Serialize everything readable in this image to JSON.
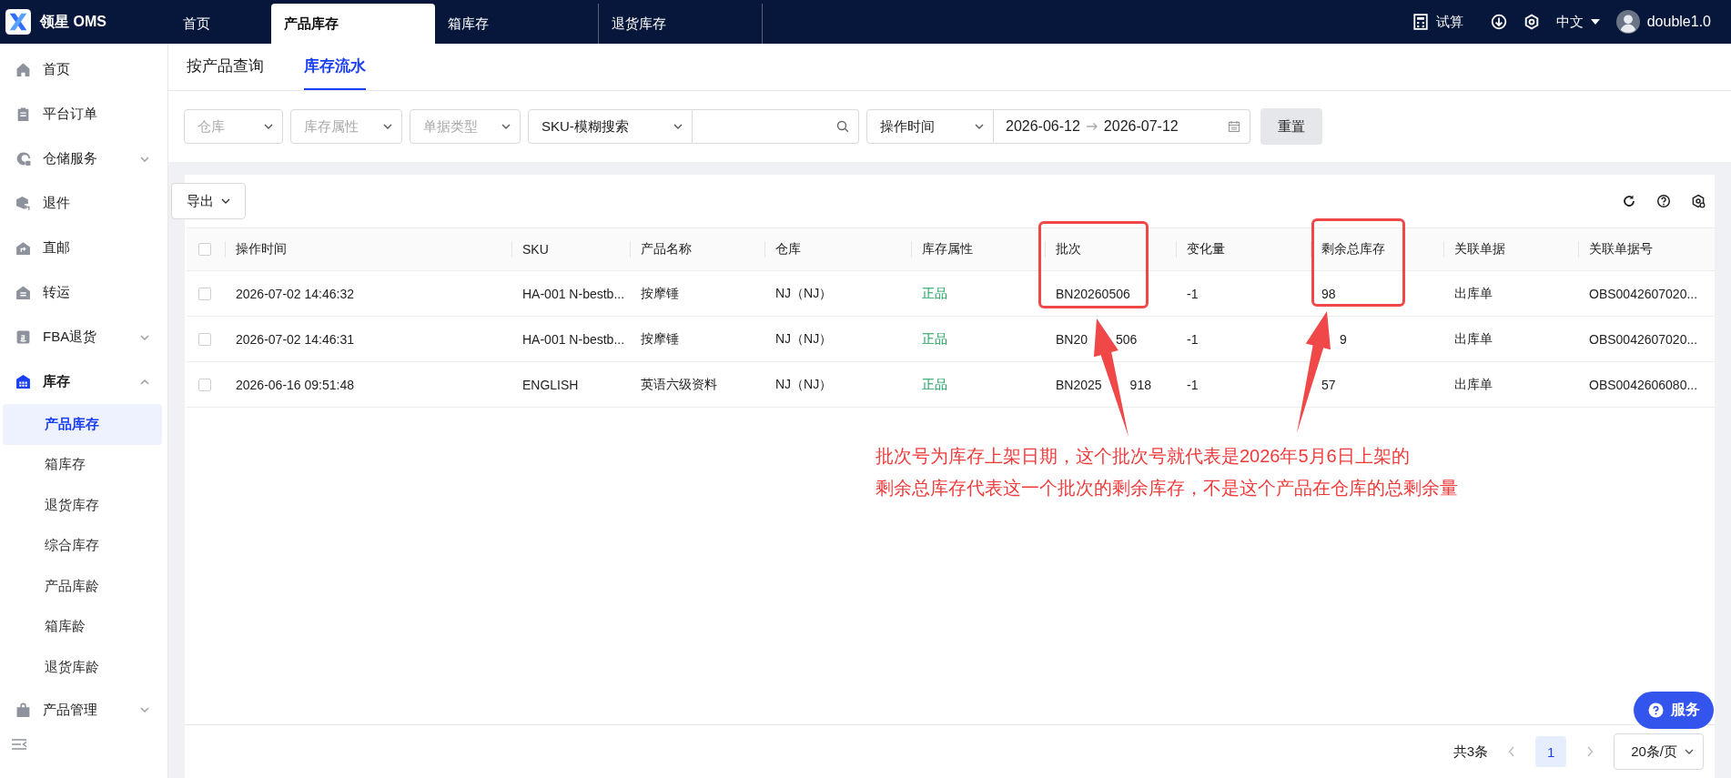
{
  "top_bar": {
    "logo_text": "领星 OMS",
    "tabs": [
      {
        "label": "首页",
        "selected": false
      },
      {
        "label": "产品库存",
        "selected": true
      },
      {
        "label": "箱库存",
        "selected": false
      },
      {
        "label": "退货库存",
        "selected": false
      }
    ],
    "calc_label": "试算",
    "language": "中文",
    "user": "double1.0"
  },
  "sidebar": {
    "items": [
      {
        "label": "首页",
        "selected": false
      },
      {
        "label": "平台订单",
        "selected": false
      },
      {
        "label": "仓储服务",
        "selected": false,
        "expanded": false
      },
      {
        "label": "退件",
        "selected": false
      },
      {
        "label": "直邮",
        "selected": false
      },
      {
        "label": "转运",
        "selected": false
      },
      {
        "label": "FBA退货",
        "selected": false,
        "expanded": false
      },
      {
        "label": "库存",
        "selected": true,
        "expanded": true,
        "children": [
          {
            "label": "产品库存",
            "selected": true
          },
          {
            "label": "箱库存",
            "selected": false
          },
          {
            "label": "退货库存",
            "selected": false
          },
          {
            "label": "综合库存",
            "selected": false
          },
          {
            "label": "产品库龄",
            "selected": false
          },
          {
            "label": "箱库龄",
            "selected": false
          },
          {
            "label": "退货库龄",
            "selected": false
          }
        ]
      },
      {
        "label": "产品管理",
        "selected": false,
        "expanded": false
      }
    ]
  },
  "sub_tabs": [
    {
      "label": "按产品查询",
      "selected": false
    },
    {
      "label": "库存流水",
      "selected": true
    }
  ],
  "filters": [
    {
      "kind": "select",
      "placeholder": "仓库"
    },
    {
      "kind": "select",
      "placeholder": "库存属性"
    },
    {
      "kind": "select",
      "placeholder": "单据类型"
    },
    {
      "kind": "search",
      "value": "SKU-模糊搜索"
    },
    {
      "kind": "daterange",
      "value": "操作时间",
      "start": "2026-06-12",
      "end": "2026-07-12"
    },
    {
      "kind": "button",
      "label": "重置"
    }
  ],
  "export_label": "导出",
  "table": {
    "all_checked": false,
    "columns": [
      {
        "label": "操作时间",
        "kind": "text"
      },
      {
        "label": "SKU",
        "kind": "text"
      },
      {
        "label": "产品名称",
        "kind": "text"
      },
      {
        "label": "仓库",
        "kind": "text"
      },
      {
        "label": "库存属性",
        "kind": "tag"
      },
      {
        "label": "批次",
        "kind": "text"
      },
      {
        "label": "变化量",
        "kind": "text"
      },
      {
        "label": "剩余总库存",
        "kind": "text"
      },
      {
        "label": "关联单据",
        "kind": "text"
      },
      {
        "label": "关联单据号",
        "kind": "text"
      }
    ],
    "rows": [
      {
        "checked": false,
        "cells": [
          "2026-07-02 14:46:32",
          "HA-001 N-bestb...",
          "按摩锤",
          "NJ（NJ）",
          "正品",
          "BN20260506",
          "-1",
          "98",
          "出库单",
          "OBS0042607020..."
        ]
      },
      {
        "checked": false,
        "cells": [
          "2026-07-02 14:46:31",
          "HA-001 N-bestb...",
          "按摩锤",
          "NJ（NJ）",
          "正品",
          [
            "BN20",
            null,
            "506"
          ],
          "-1",
          [
            null,
            "9"
          ],
          "出库单",
          "OBS0042607020..."
        ]
      },
      {
        "checked": false,
        "cells": [
          "2026-06-16 09:51:48",
          "ENGLISH",
          "英语六级资料",
          "NJ（NJ）",
          "正品",
          [
            "BN2025",
            null,
            "918"
          ],
          "-1",
          "57",
          "出库单",
          "OBS0042606080..."
        ]
      }
    ]
  },
  "pagination": {
    "total": "共3条",
    "pages": [
      {
        "label": "1",
        "selected": true
      }
    ],
    "page_size": "20条/页"
  },
  "service_label": "服务",
  "annotation": {
    "lines": [
      "批次号为库存上架日期，这个批次号就代表是2026年5月6日上架的",
      "剩余总库存代表这一个批次的剩余库存，不是这个产品在仓库的总剩余量"
    ]
  }
}
